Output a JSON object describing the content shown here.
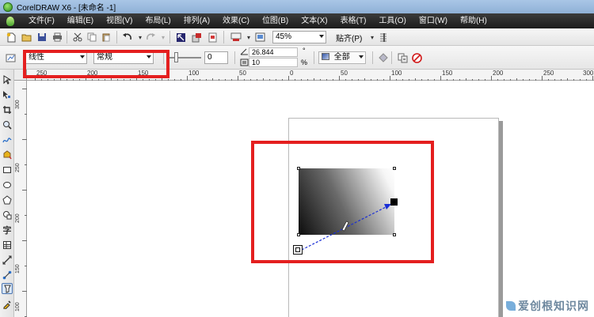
{
  "window": {
    "title": "CorelDRAW X6 - [未命名 -1]"
  },
  "menu": [
    "文件(F)",
    "编辑(E)",
    "视图(V)",
    "布局(L)",
    "排列(A)",
    "效果(C)",
    "位图(B)",
    "文本(X)",
    "表格(T)",
    "工具(O)",
    "窗口(W)",
    "帮助(H)"
  ],
  "std_toolbar": {
    "zoom": "45%",
    "snap": "贴齐(P)"
  },
  "prop_bar": {
    "fill_type": "线性",
    "fill_mode": "常规",
    "slider_value": "0",
    "angle": "26.844",
    "edge_pad": "10",
    "degree_symbol": "°",
    "percent_symbol": "%",
    "scope": "全部"
  },
  "ruler_h": [
    "250",
    "200",
    "150",
    "100",
    "50",
    "0",
    "50",
    "100",
    "150",
    "200",
    "250",
    "300"
  ],
  "ruler_v": [
    "300",
    "250",
    "200",
    "150",
    "100"
  ],
  "watermark": "爱创根知识网",
  "colors": {
    "highlight": "#e41f1f",
    "vector_arrow": "#1a2fd6"
  }
}
